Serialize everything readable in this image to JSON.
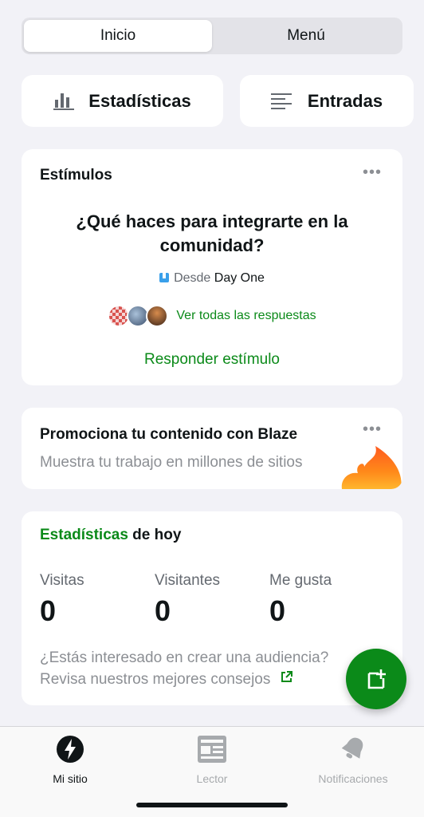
{
  "segmented": {
    "tabs": [
      "Inicio",
      "Menú"
    ],
    "active_index": 0
  },
  "quick_actions": {
    "stats_label": "Estadísticas",
    "posts_label": "Entradas"
  },
  "prompt_card": {
    "title": "Estímulos",
    "question": "¿Qué haces para integrarte en la comunidad?",
    "source_prefix": "Desde",
    "source_name": "Day One",
    "answers_link": "Ver todas las respuestas",
    "respond_label": "Responder estímulo",
    "more_icon": "ellipsis-icon"
  },
  "blaze_card": {
    "title": "Promociona tu contenido con Blaze",
    "subtitle": "Muestra tu trabajo en millones de sitios",
    "icon": "flame-icon"
  },
  "stats_card": {
    "title_highlight": "Estadísticas",
    "title_rest": " de hoy",
    "columns": [
      {
        "label": "Visitas",
        "value": "0"
      },
      {
        "label": "Visitantes",
        "value": "0"
      },
      {
        "label": "Me gusta",
        "value": "0"
      }
    ],
    "tip_line1": "¿Estás interesado en crear una audiencia?",
    "tip_line2": "Revisa nuestros mejores consejos"
  },
  "tabbar": {
    "items": [
      {
        "label": "Mi sitio",
        "icon": "my-site-icon",
        "active": true
      },
      {
        "label": "Lector",
        "icon": "reader-icon",
        "active": false
      },
      {
        "label": "Notificaciones",
        "icon": "bell-icon",
        "active": false
      }
    ]
  },
  "colors": {
    "accent": "#0b8a19",
    "background": "#f2f2f7"
  }
}
